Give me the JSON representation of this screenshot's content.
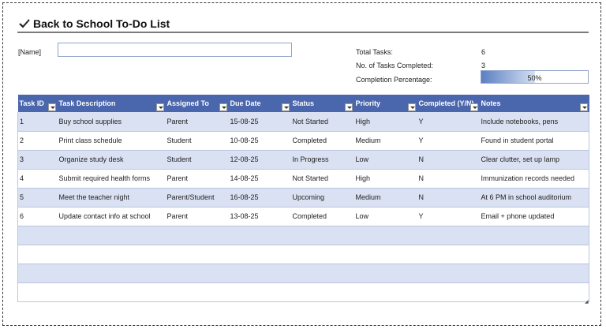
{
  "header": {
    "title": "Back to School To-Do List",
    "icon": "check-icon"
  },
  "name_field": {
    "label": "[Name]",
    "value": ""
  },
  "summary": {
    "total_label": "Total Tasks:",
    "total_value": "6",
    "completed_label": "No. of Tasks Completed:",
    "completed_value": "3",
    "percentage_label": "Completion Percentage:",
    "percentage_text": "50%",
    "percentage_fraction": 0.5
  },
  "table": {
    "columns": [
      "Task ID",
      "Task Description",
      "Assigned To",
      "Due Date",
      "Status",
      "Priority",
      "Completed (Y/N)",
      "Notes"
    ],
    "rows": [
      [
        "1",
        "Buy school supplies",
        "Parent",
        "15-08-25",
        "Not Started",
        "High",
        "Y",
        "Include notebooks, pens"
      ],
      [
        "2",
        "Print class schedule",
        "Student",
        "10-08-25",
        "Completed",
        "Medium",
        "Y",
        "Found in student portal"
      ],
      [
        "3",
        "Organize study desk",
        "Student",
        "12-08-25",
        "In Progress",
        "Low",
        "N",
        "Clear clutter, set up lamp"
      ],
      [
        "4",
        "Submit required health forms",
        "Parent",
        "14-08-25",
        "Not Started",
        "High",
        "N",
        "Immunization records needed"
      ],
      [
        "5",
        "Meet the teacher night",
        "Parent/Student",
        "16-08-25",
        "Upcoming",
        "Medium",
        "N",
        "At 6 PM in school auditorium"
      ],
      [
        "6",
        "Update contact info at school",
        "Parent",
        "13-08-25",
        "Completed",
        "Low",
        "Y",
        "Email + phone updated"
      ],
      [
        "",
        "",
        "",
        "",
        "",
        "",
        "",
        ""
      ],
      [
        "",
        "",
        "",
        "",
        "",
        "",
        "",
        ""
      ],
      [
        "",
        "",
        "",
        "",
        "",
        "",
        "",
        ""
      ],
      [
        "",
        "",
        "",
        "",
        "",
        "",
        "",
        ""
      ]
    ]
  },
  "colors": {
    "header_bg": "#4a66ac",
    "band": "#d9e1f2",
    "progress": "#5b7fc2"
  }
}
